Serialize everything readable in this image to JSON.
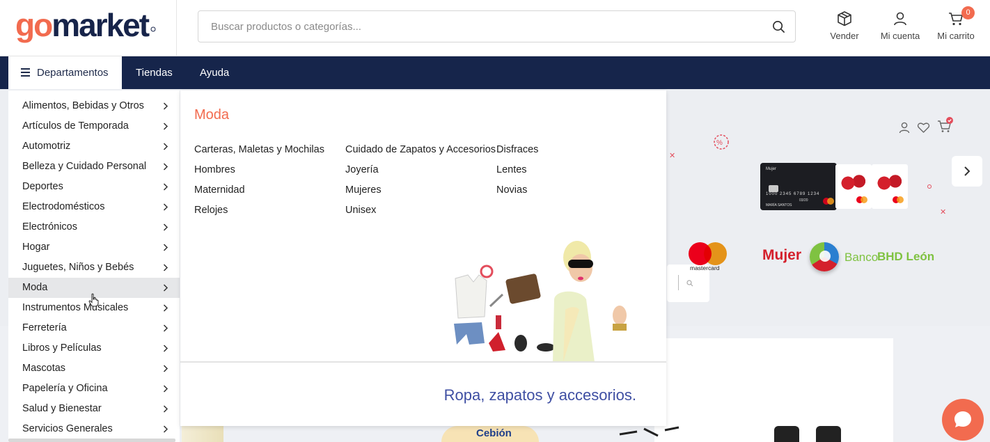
{
  "header": {
    "logo_text": "gomarket",
    "search_placeholder": "Buscar productos o categorías...",
    "actions": [
      {
        "label": "Vender",
        "icon": "box-icon"
      },
      {
        "label": "Mi cuenta",
        "icon": "user-icon"
      },
      {
        "label": "Mi carrito",
        "icon": "cart-icon",
        "badge": "0"
      }
    ]
  },
  "nav": {
    "departments_label": "Departamentos",
    "links": [
      "Tiendas",
      "Ayuda"
    ]
  },
  "departments": [
    "Alimentos, Bebidas y Otros",
    "Artículos de Temporada",
    "Automotriz",
    "Belleza y Cuidado Personal",
    "Deportes",
    "Electrodomésticos",
    "Electrónicos",
    "Hogar",
    "Juguetes, Niños y Bebés",
    "Moda",
    "Instrumentos Musicales",
    "Ferretería",
    "Libros y Películas",
    "Mascotas",
    "Papelería y Oficina",
    "Salud y Bienestar",
    "Servicios Generales"
  ],
  "active_department": "Moda",
  "panel": {
    "title": "Moda",
    "columns": [
      [
        "Carteras, Maletas y Mochilas",
        "Hombres",
        "Maternidad",
        "Relojes"
      ],
      [
        "Cuidado de Zapatos y Accesorios",
        "Joyería",
        "Mujeres",
        "Unisex"
      ],
      [
        "Disfraces",
        "Lentes",
        "Novias"
      ]
    ],
    "tagline": "Ropa, zapatos y accesorios."
  },
  "hero": {
    "mastercard_label": "mastercard",
    "brand_mujer": "Mujer",
    "bank_prefix": "Banco",
    "bank_name": "BHD León",
    "card_holder": "MARÍA SANTOS",
    "card_number": "1000 2345 6789 1234",
    "card_expiry": "03/20"
  },
  "strip": {
    "product_brand": "Cebión"
  },
  "colors": {
    "brand": "#f26b4f",
    "navbar": "#16254b",
    "tagline": "#3f4fa3",
    "bhd_green": "#7fc241"
  }
}
